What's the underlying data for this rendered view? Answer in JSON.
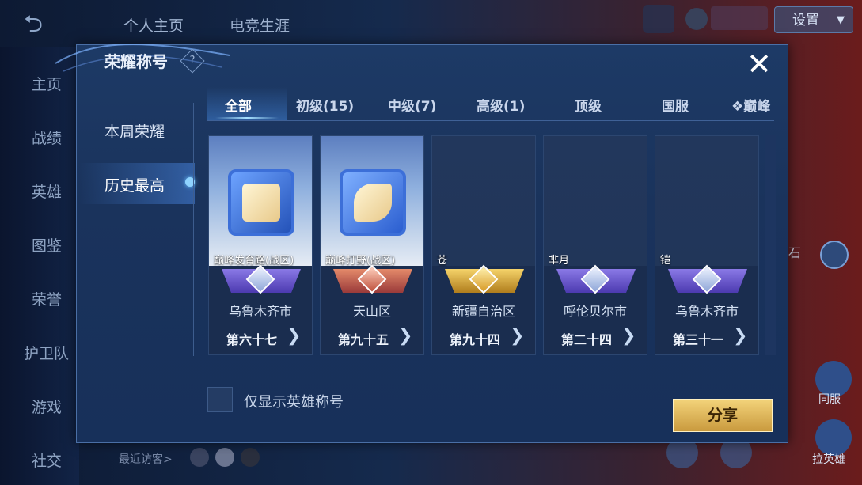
{
  "background": {
    "top_tabs": [
      "个人主页",
      "电竞生涯"
    ],
    "side_items": [
      "主页",
      "战绩",
      "英雄",
      "图鉴",
      "荣誉",
      "护卫队",
      "游戏",
      "社交"
    ],
    "settings_label": "设置",
    "recent_visitors_label": "最近访客>",
    "right_items": [
      "同服",
      "拉英雄"
    ],
    "partial_text": "石"
  },
  "modal": {
    "title": "荣耀称号",
    "help_glyph": "?",
    "close_glyph": "✕",
    "left_nav": [
      "本周荣耀",
      "历史最高"
    ],
    "active_nav": "历史最高",
    "tabs": [
      "全部",
      "初级(15)",
      "中级(7)",
      "高级(1)",
      "顶级",
      "国服",
      "❖巅峰"
    ],
    "active_tab": "全部",
    "cards": [
      {
        "name": "巅峰发育路(战区)",
        "region": "乌鲁木齐市",
        "rank": "第六十七",
        "style": "lit",
        "ribbon": "purple"
      },
      {
        "name": "巅峰打野(战区)",
        "region": "天山区",
        "rank": "第九十五",
        "style": "lit",
        "ribbon": "red"
      },
      {
        "name": "苍",
        "region": "新疆自治区",
        "rank": "第九十四",
        "style": "dim",
        "ribbon": "gold"
      },
      {
        "name": "芈月",
        "region": "呼伦贝尔市",
        "rank": "第二十四",
        "style": "dim",
        "ribbon": "purple"
      },
      {
        "name": "铠",
        "region": "乌鲁木齐市",
        "rank": "第三十一",
        "style": "dim",
        "ribbon": "purple"
      }
    ],
    "arrow_glyph": "❯",
    "checkbox_label": "仅显示英雄称号",
    "checkbox_checked": false,
    "share_label": "分享"
  },
  "colors": {
    "accent": "#8fd3ff",
    "share_button": "#e6bd62",
    "modal_bg": "#1d3a66"
  }
}
